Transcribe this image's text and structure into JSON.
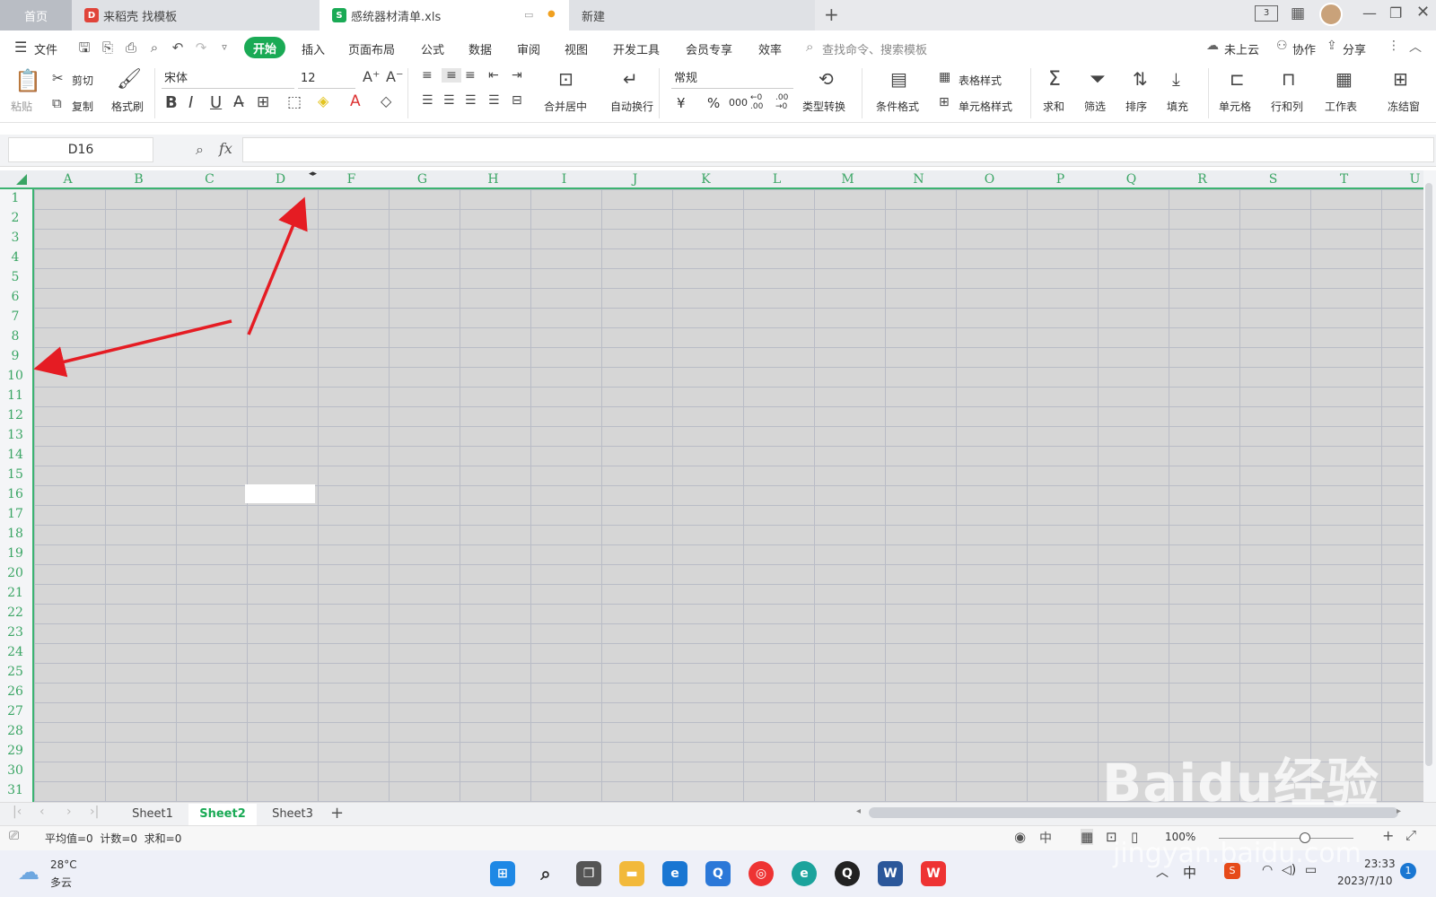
{
  "tabs": [
    {
      "label": "首页"
    },
    {
      "label": "来稻壳 找模板"
    },
    {
      "label": "感统器材清单.xls"
    },
    {
      "label": "新建"
    }
  ],
  "menu": {
    "file": "文件",
    "items": [
      "开始",
      "插入",
      "页面布局",
      "公式",
      "数据",
      "审阅",
      "视图",
      "开发工具",
      "会员专享",
      "效率"
    ],
    "search_placeholder": "查找命令、搜索模板",
    "cloud": "未上云",
    "collab": "协作",
    "share": "分享"
  },
  "ribbon": {
    "paste": "粘贴",
    "cut": "剪切",
    "copy": "复制",
    "format_painter": "格式刷",
    "font_name": "宋体",
    "font_size": "12",
    "merge_center": "合并居中",
    "wrap": "自动换行",
    "number_format": "常规",
    "type_convert": "类型转换",
    "conditional_format": "条件格式",
    "table_style": "表格样式",
    "cell_style": "单元格样式",
    "sum": "求和",
    "filter": "筛选",
    "sort": "排序",
    "fill": "填充",
    "cell": "单元格",
    "row_col": "行和列",
    "worksheet": "工作表",
    "freeze": "冻结窗",
    "currency": "¥",
    "percent": "%",
    "thousands": "000",
    "inc_dec": "←0 .00",
    "dec_dec": ".00 →0"
  },
  "formula_bar": {
    "name_box": "D16",
    "fx": "fx",
    "value": ""
  },
  "columns": [
    "A",
    "B",
    "C",
    "D",
    "F",
    "G",
    "H",
    "I",
    "J",
    "K",
    "L",
    "M",
    "N",
    "O",
    "P",
    "Q",
    "R",
    "S",
    "T",
    "U"
  ],
  "rows": [
    "1",
    "2",
    "3",
    "4",
    "5",
    "6",
    "7",
    "8",
    "9",
    "10",
    "11",
    "12",
    "13",
    "14",
    "15",
    "16",
    "17",
    "18",
    "19",
    "20",
    "21",
    "22",
    "23",
    "24",
    "25",
    "26",
    "27",
    "28",
    "29",
    "30",
    "31"
  ],
  "sheets": [
    {
      "name": "Sheet1",
      "active": false
    },
    {
      "name": "Sheet2",
      "active": true
    },
    {
      "name": "Sheet3",
      "active": false
    }
  ],
  "status": {
    "stats": "平均值=0  计数=0  求和=0",
    "zoom": "100%"
  },
  "taskbar": {
    "weather_temp": "28°C",
    "weather_desc": "多云",
    "ime": "中",
    "time": "23:33",
    "date": "2023/7/10",
    "notif_count": "1"
  },
  "watermark": {
    "brand": "Baidu经验",
    "url": "jingyan.baidu.com"
  },
  "colors": {
    "accent_green": "#1aaa55",
    "header_text_green": "#3aa564",
    "grid_fill": "#d6d6d6",
    "arrow_red": "#e51c23"
  }
}
